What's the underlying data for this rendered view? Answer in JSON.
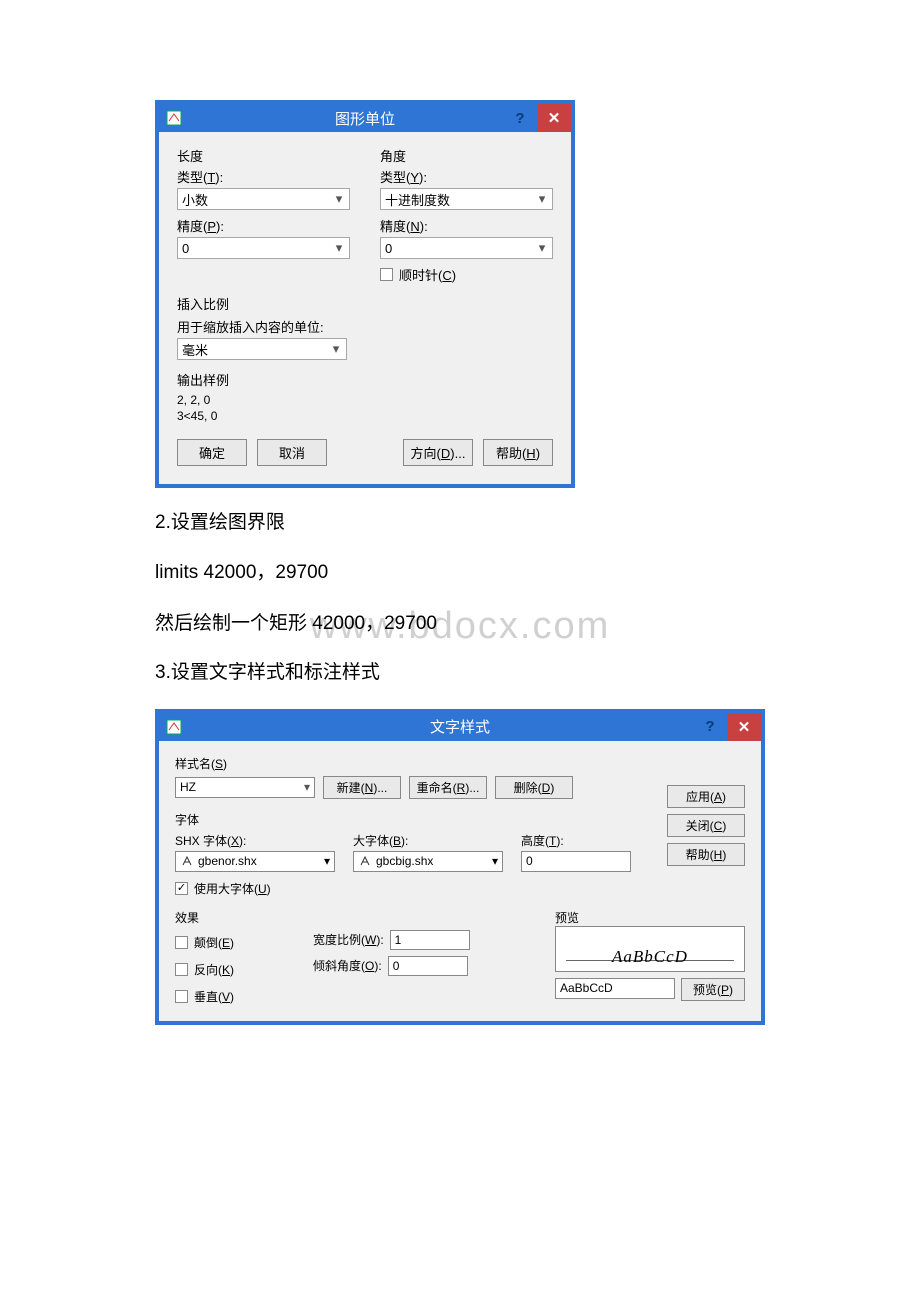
{
  "dialog1": {
    "title": "图形单位",
    "length": {
      "header": "长度",
      "type_label_prefix": "类型(",
      "type_hotkey": "T",
      "type_label_suffix": "):",
      "type_value": "小数",
      "precision_label_prefix": "精度(",
      "precision_hotkey": "P",
      "precision_label_suffix": "):",
      "precision_value": "0"
    },
    "angle": {
      "header": "角度",
      "type_label_prefix": "类型(",
      "type_hotkey": "Y",
      "type_label_suffix": "):",
      "type_value": "十进制度数",
      "precision_label_prefix": "精度(",
      "precision_hotkey": "N",
      "precision_label_suffix": "):",
      "precision_value": "0",
      "clockwise_prefix": "顺时针(",
      "clockwise_hotkey": "C",
      "clockwise_suffix": ")"
    },
    "insert_scale": {
      "header": "插入比例",
      "desc": "用于缩放插入内容的单位:",
      "value": "毫米"
    },
    "output_sample": {
      "header": "输出样例",
      "line1": "2, 2, 0",
      "line2": "3<45, 0"
    },
    "buttons": {
      "ok": "确定",
      "cancel": "取消",
      "direction_prefix": "方向(",
      "direction_hotkey": "D",
      "direction_suffix": ")...",
      "help_prefix": "帮助(",
      "help_hotkey": "H",
      "help_suffix": ")"
    }
  },
  "text": {
    "step2": "2.设置绘图界限",
    "limits": "limits 42000，29700",
    "rect": "然后绘制一个矩形 42000，29700",
    "step3": "3.设置文字样式和标注样式",
    "watermark": "www.bdocx.com"
  },
  "dialog2": {
    "title": "文字样式",
    "style_name": {
      "label_prefix": "样式名(",
      "label_hotkey": "S",
      "label_suffix": ")",
      "value": "HZ",
      "new_prefix": "新建(",
      "new_hotkey": "N",
      "new_suffix": ")...",
      "rename_prefix": "重命名(",
      "rename_hotkey": "R",
      "rename_suffix": ")...",
      "delete_prefix": "删除(",
      "delete_hotkey": "D",
      "delete_suffix": ")"
    },
    "sidebtns": {
      "apply_prefix": "应用(",
      "apply_hotkey": "A",
      "apply_suffix": ")",
      "close_prefix": "关闭(",
      "close_hotkey": "C",
      "close_suffix": ")",
      "help_prefix": "帮助(",
      "help_hotkey": "H",
      "help_suffix": ")"
    },
    "font": {
      "header": "字体",
      "shx_label_prefix": "SHX 字体(",
      "shx_hotkey": "X",
      "shx_label_suffix": "):",
      "shx_value": "gbenor.shx",
      "big_label_prefix": "大字体(",
      "big_hotkey": "B",
      "big_label_suffix": "):",
      "big_value": "gbcbig.shx",
      "height_label_prefix": "高度(",
      "height_hotkey": "T",
      "height_label_suffix": "):",
      "height_value": "0",
      "usebig_prefix": "使用大字体(",
      "usebig_hotkey": "U",
      "usebig_suffix": ")"
    },
    "effects": {
      "header": "效果",
      "upside_prefix": "颠倒(",
      "upside_hotkey": "E",
      "upside_suffix": ")",
      "backward_prefix": "反向(",
      "backward_hotkey": "K",
      "backward_suffix": ")",
      "vertical_prefix": "垂直(",
      "vertical_hotkey": "V",
      "vertical_suffix": ")",
      "width_label_prefix": "宽度比例(",
      "width_hotkey": "W",
      "width_label_suffix": "):",
      "width_value": "1",
      "oblique_label_prefix": "倾斜角度(",
      "oblique_hotkey": "O",
      "oblique_label_suffix": "):",
      "oblique_value": "0"
    },
    "preview": {
      "header": "预览",
      "sample": "AaBbCcD",
      "input_value": "AaBbCcD",
      "btn_prefix": "预览(",
      "btn_hotkey": "P",
      "btn_suffix": ")"
    }
  }
}
